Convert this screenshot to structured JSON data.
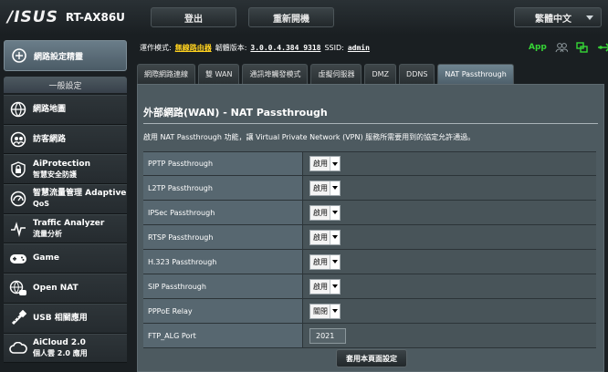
{
  "header": {
    "brand": "/ISUS",
    "model": "RT-AX86U",
    "logout_label": "登出",
    "reboot_label": "重新開機",
    "language_label": "繁體中文"
  },
  "sidebar": {
    "quick_setup_label": "網路設定精靈",
    "general_label": "一般設定",
    "items": [
      {
        "l1": "網路地圖",
        "l2": "",
        "icon": "globe-icon"
      },
      {
        "l1": "訪客網路",
        "l2": "",
        "icon": "guest-network-icon"
      },
      {
        "l1": "AiProtection",
        "l2": "智慧安全防護",
        "icon": "lock-icon"
      },
      {
        "l1": "智慧流量管理 Adaptive",
        "l2": "QoS",
        "icon": "gauge-icon"
      },
      {
        "l1": "Traffic Analyzer",
        "l2": "流量分析",
        "icon": "traffic-analyzer-icon"
      },
      {
        "l1": "Game",
        "l2": "",
        "icon": "gamepad-icon"
      },
      {
        "l1": "Open NAT",
        "l2": "",
        "icon": "open-nat-icon"
      },
      {
        "l1": "USB 相關應用",
        "l2": "",
        "icon": "usb-icon"
      },
      {
        "l1": "AiCloud 2.0",
        "l2": "個人雲 2.0 應用",
        "icon": "cloud-icon"
      }
    ]
  },
  "status": {
    "mode_label": "運作模式:",
    "mode_value": "無線路由器",
    "fw_label": "韌體版本:",
    "fw_value": "3.0.0.4.384_9318",
    "ssid_label": "SSID:",
    "ssid_value": "admin",
    "app_label": "App"
  },
  "tabs": [
    {
      "label": "網際網路連線"
    },
    {
      "label": "雙 WAN"
    },
    {
      "label": "通訊埠觸發模式"
    },
    {
      "label": "虛擬伺服器"
    },
    {
      "label": "DMZ"
    },
    {
      "label": "DDNS"
    },
    {
      "label": "NAT Passthrough"
    }
  ],
  "panel": {
    "title": "外部網路(WAN) - NAT Passthrough",
    "description": "啟用 NAT Passthrough 功能，讓 Virtual Private Network (VPN) 服務所需要用到的協定允許通過。",
    "rows": [
      {
        "label": "PPTP Passthrough",
        "value": "啟用"
      },
      {
        "label": "L2TP Passthrough",
        "value": "啟用"
      },
      {
        "label": "IPSec Passthrough",
        "value": "啟用"
      },
      {
        "label": "RTSP Passthrough",
        "value": "啟用"
      },
      {
        "label": "H.323 Passthrough",
        "value": "啟用"
      },
      {
        "label": "SIP Passthrough",
        "value": "啟用"
      },
      {
        "label": "PPPoE Relay",
        "value": "關閉"
      }
    ],
    "ftp_alg_label": "FTP_ALG Port",
    "ftp_alg_value": "2021",
    "apply_label": "套用本頁面設定"
  },
  "colors": {
    "active_tab": "#5f7581",
    "accent_yellow": "#ffd21f",
    "status_green": "#36d636"
  }
}
